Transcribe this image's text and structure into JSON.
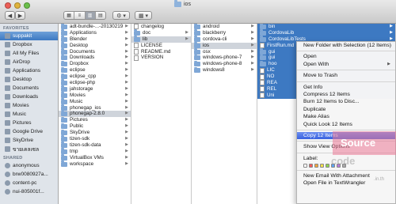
{
  "window": {
    "title": "ios",
    "back_label": "◀",
    "forward_label": "▶"
  },
  "toolbar": {
    "view_modes": [
      "▦",
      "≡",
      "▥",
      "▤"
    ],
    "action_label": "⚙ ▾",
    "arrange_label": "▦ ▾"
  },
  "sidebar": {
    "favorites_header": "FAVORITES",
    "favorites": [
      {
        "label": "suppakit",
        "icon": "home-icon",
        "selected": true
      },
      {
        "label": "Dropbox",
        "icon": "dropbox-icon"
      },
      {
        "label": "All My Files",
        "icon": "all-files-icon"
      },
      {
        "label": "AirDrop",
        "icon": "airdrop-icon"
      },
      {
        "label": "Applications",
        "icon": "applications-icon"
      },
      {
        "label": "Desktop",
        "icon": "desktop-icon"
      },
      {
        "label": "Documents",
        "icon": "documents-icon"
      },
      {
        "label": "Downloads",
        "icon": "downloads-icon"
      },
      {
        "label": "Movies",
        "icon": "movies-icon"
      },
      {
        "label": "Music",
        "icon": "music-icon"
      },
      {
        "label": "Pictures",
        "icon": "pictures-icon"
      },
      {
        "label": "Google Drive",
        "icon": "google-drive-icon"
      },
      {
        "label": "SkyDrive",
        "icon": "skydrive-icon"
      },
      {
        "label": "ขายเคลเซล",
        "icon": "folder-icon"
      }
    ],
    "shared_header": "SHARED",
    "shared": [
      {
        "label": "anonymous",
        "icon": "network-icon"
      },
      {
        "label": "brw0080927a...",
        "icon": "network-icon"
      },
      {
        "label": "content-pc",
        "icon": "network-icon"
      },
      {
        "label": "nui-805001f...",
        "icon": "network-icon"
      }
    ]
  },
  "columns": [
    {
      "items": [
        {
          "label": "adt-bundle-...-20130219",
          "type": "folder",
          "arrow": true
        },
        {
          "label": "Applications",
          "type": "folder",
          "arrow": true
        },
        {
          "label": "Blender",
          "type": "folder",
          "arrow": true
        },
        {
          "label": "Desktop",
          "type": "folder",
          "arrow": true
        },
        {
          "label": "Documents",
          "type": "folder",
          "arrow": true
        },
        {
          "label": "Downloads",
          "type": "folder",
          "arrow": true
        },
        {
          "label": "Dropbox",
          "type": "folder",
          "arrow": true
        },
        {
          "label": "eclipse",
          "type": "folder",
          "arrow": true
        },
        {
          "label": "eclipse_cpp",
          "type": "folder",
          "arrow": true
        },
        {
          "label": "eclipse-php",
          "type": "folder",
          "arrow": true
        },
        {
          "label": "jahstorage",
          "type": "folder",
          "arrow": true
        },
        {
          "label": "Movies",
          "type": "folder",
          "arrow": true
        },
        {
          "label": "Music",
          "type": "folder",
          "arrow": true
        },
        {
          "label": "phonegap_ios",
          "type": "folder",
          "arrow": true
        },
        {
          "label": "phonegap-2.8.0",
          "type": "folder",
          "arrow": true,
          "state": "highlight"
        },
        {
          "label": "Pictures",
          "type": "folder",
          "arrow": true
        },
        {
          "label": "Public",
          "type": "folder",
          "arrow": true
        },
        {
          "label": "SkyDrive",
          "type": "folder",
          "arrow": true
        },
        {
          "label": "tizen-sdk",
          "type": "folder",
          "arrow": true
        },
        {
          "label": "tizen-sdk-data",
          "type": "folder",
          "arrow": true
        },
        {
          "label": "tmp",
          "type": "folder",
          "arrow": true
        },
        {
          "label": "VirtualBox VMs",
          "type": "folder",
          "arrow": true
        },
        {
          "label": "workspace",
          "type": "folder",
          "arrow": true
        }
      ]
    },
    {
      "items": [
        {
          "label": "changelog",
          "type": "file"
        },
        {
          "label": "doc",
          "type": "folder",
          "arrow": true
        },
        {
          "label": "lib",
          "type": "folder",
          "arrow": true,
          "state": "highlight"
        },
        {
          "label": "LICENSE",
          "type": "file"
        },
        {
          "label": "README.md",
          "type": "file"
        },
        {
          "label": "VERSION",
          "type": "file"
        }
      ]
    },
    {
      "items": [
        {
          "label": "android",
          "type": "folder",
          "arrow": true
        },
        {
          "label": "blackberry",
          "type": "folder",
          "arrow": true
        },
        {
          "label": "cordova-cli",
          "type": "folder",
          "arrow": true
        },
        {
          "label": "ios",
          "type": "folder",
          "arrow": true,
          "state": "highlight"
        },
        {
          "label": "osx",
          "type": "folder",
          "arrow": true
        },
        {
          "label": "windows-phone-7",
          "type": "folder",
          "arrow": true
        },
        {
          "label": "windows-phone-8",
          "type": "folder",
          "arrow": true
        },
        {
          "label": "windows8",
          "type": "folder",
          "arrow": true
        }
      ]
    },
    {
      "items": [
        {
          "label": "bin",
          "type": "folder",
          "arrow": true,
          "state": "blue"
        },
        {
          "label": "CordovaLib",
          "type": "folder",
          "arrow": true,
          "state": "blue"
        },
        {
          "label": "CordovaLibTests",
          "type": "folder",
          "arrow": true,
          "state": "blue"
        },
        {
          "label": "FirstRun.md",
          "type": "file",
          "state": "blue"
        },
        {
          "label": "gui",
          "type": "folder",
          "state": "blue"
        },
        {
          "label": "gui",
          "type": "folder",
          "state": "blue"
        },
        {
          "label": "hoo",
          "type": "folder",
          "state": "blue"
        },
        {
          "label": "LIC",
          "type": "file",
          "state": "blue"
        },
        {
          "label": "NO",
          "type": "file",
          "state": "blue"
        },
        {
          "label": "REA",
          "type": "file",
          "state": "blue"
        },
        {
          "label": "REL",
          "type": "file",
          "state": "blue"
        },
        {
          "label": "Uni",
          "type": "file",
          "state": "blue"
        }
      ]
    }
  ],
  "context_menu": {
    "groups": [
      [
        {
          "label": "New Folder with Selection (12 Items)"
        }
      ],
      [
        {
          "label": "Open"
        },
        {
          "label": "Open With",
          "submenu": true
        }
      ],
      [
        {
          "label": "Move to Trash"
        }
      ],
      [
        {
          "label": "Get Info"
        },
        {
          "label": "Compress 12 Items"
        },
        {
          "label": "Burn 12 Items to Disc..."
        },
        {
          "label": "Duplicate"
        },
        {
          "label": "Make Alias"
        },
        {
          "label": "Quick Look 12 Items"
        }
      ],
      [
        {
          "label": "Copy 12 Items",
          "active": true
        }
      ],
      [
        {
          "label": "Show View Options"
        }
      ],
      [
        {
          "label": "Label:"
        }
      ],
      [
        {
          "label": "New Email With Attachment"
        },
        {
          "label": "Open File in TextWrangler"
        }
      ]
    ],
    "label_colors": [
      "#ffffff",
      "#f25c5c",
      "#f5a63c",
      "#f3df4b",
      "#8fd44c",
      "#5ea2f0",
      "#b97ad9",
      "#a8a8a8"
    ]
  },
  "watermark": {
    "line1": "Source",
    "line2": "code",
    "line3": ".in.th"
  }
}
